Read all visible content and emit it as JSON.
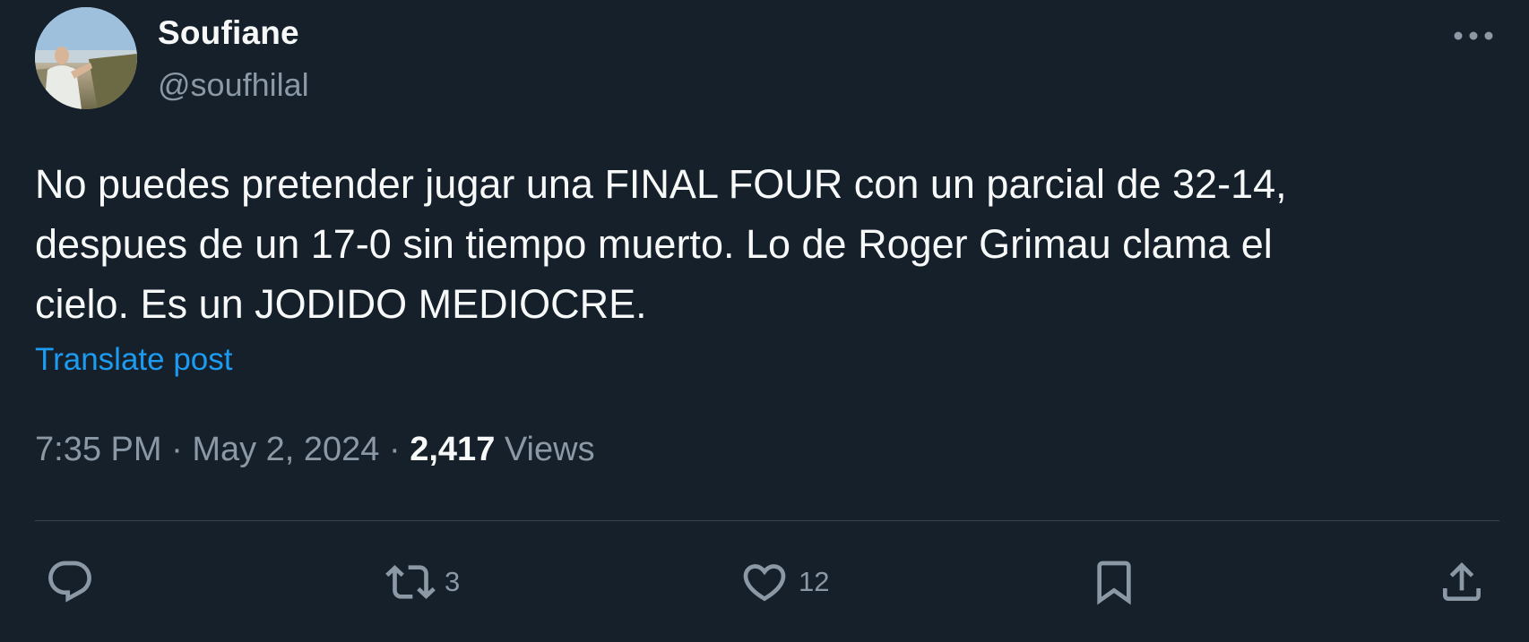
{
  "author": {
    "display_name": "Soufiane",
    "handle": "@soufhilal"
  },
  "post": {
    "text": "No puedes pretender jugar una FINAL FOUR con un parcial de 32-14,\ndespues de un 17-0 sin tiempo muerto. Lo de Roger Grimau clama el\ncielo. Es un JODIDO MEDIOCRE.",
    "translate_label": "Translate post"
  },
  "meta": {
    "time": "7:35 PM",
    "date": "May 2, 2024",
    "views_count": "2,417",
    "views_label": "Views",
    "separator": "·"
  },
  "actions": {
    "reply_icon": "reply-icon",
    "retweet_icon": "retweet-icon",
    "retweet_count": "3",
    "like_icon": "heart-icon",
    "like_count": "12",
    "bookmark_icon": "bookmark-icon",
    "share_icon": "share-icon"
  },
  "colors": {
    "background": "#15202b",
    "primary_text": "#f7f9f9",
    "secondary_text": "#8b98a5",
    "link": "#1d9bf0",
    "divider": "#38444d"
  }
}
